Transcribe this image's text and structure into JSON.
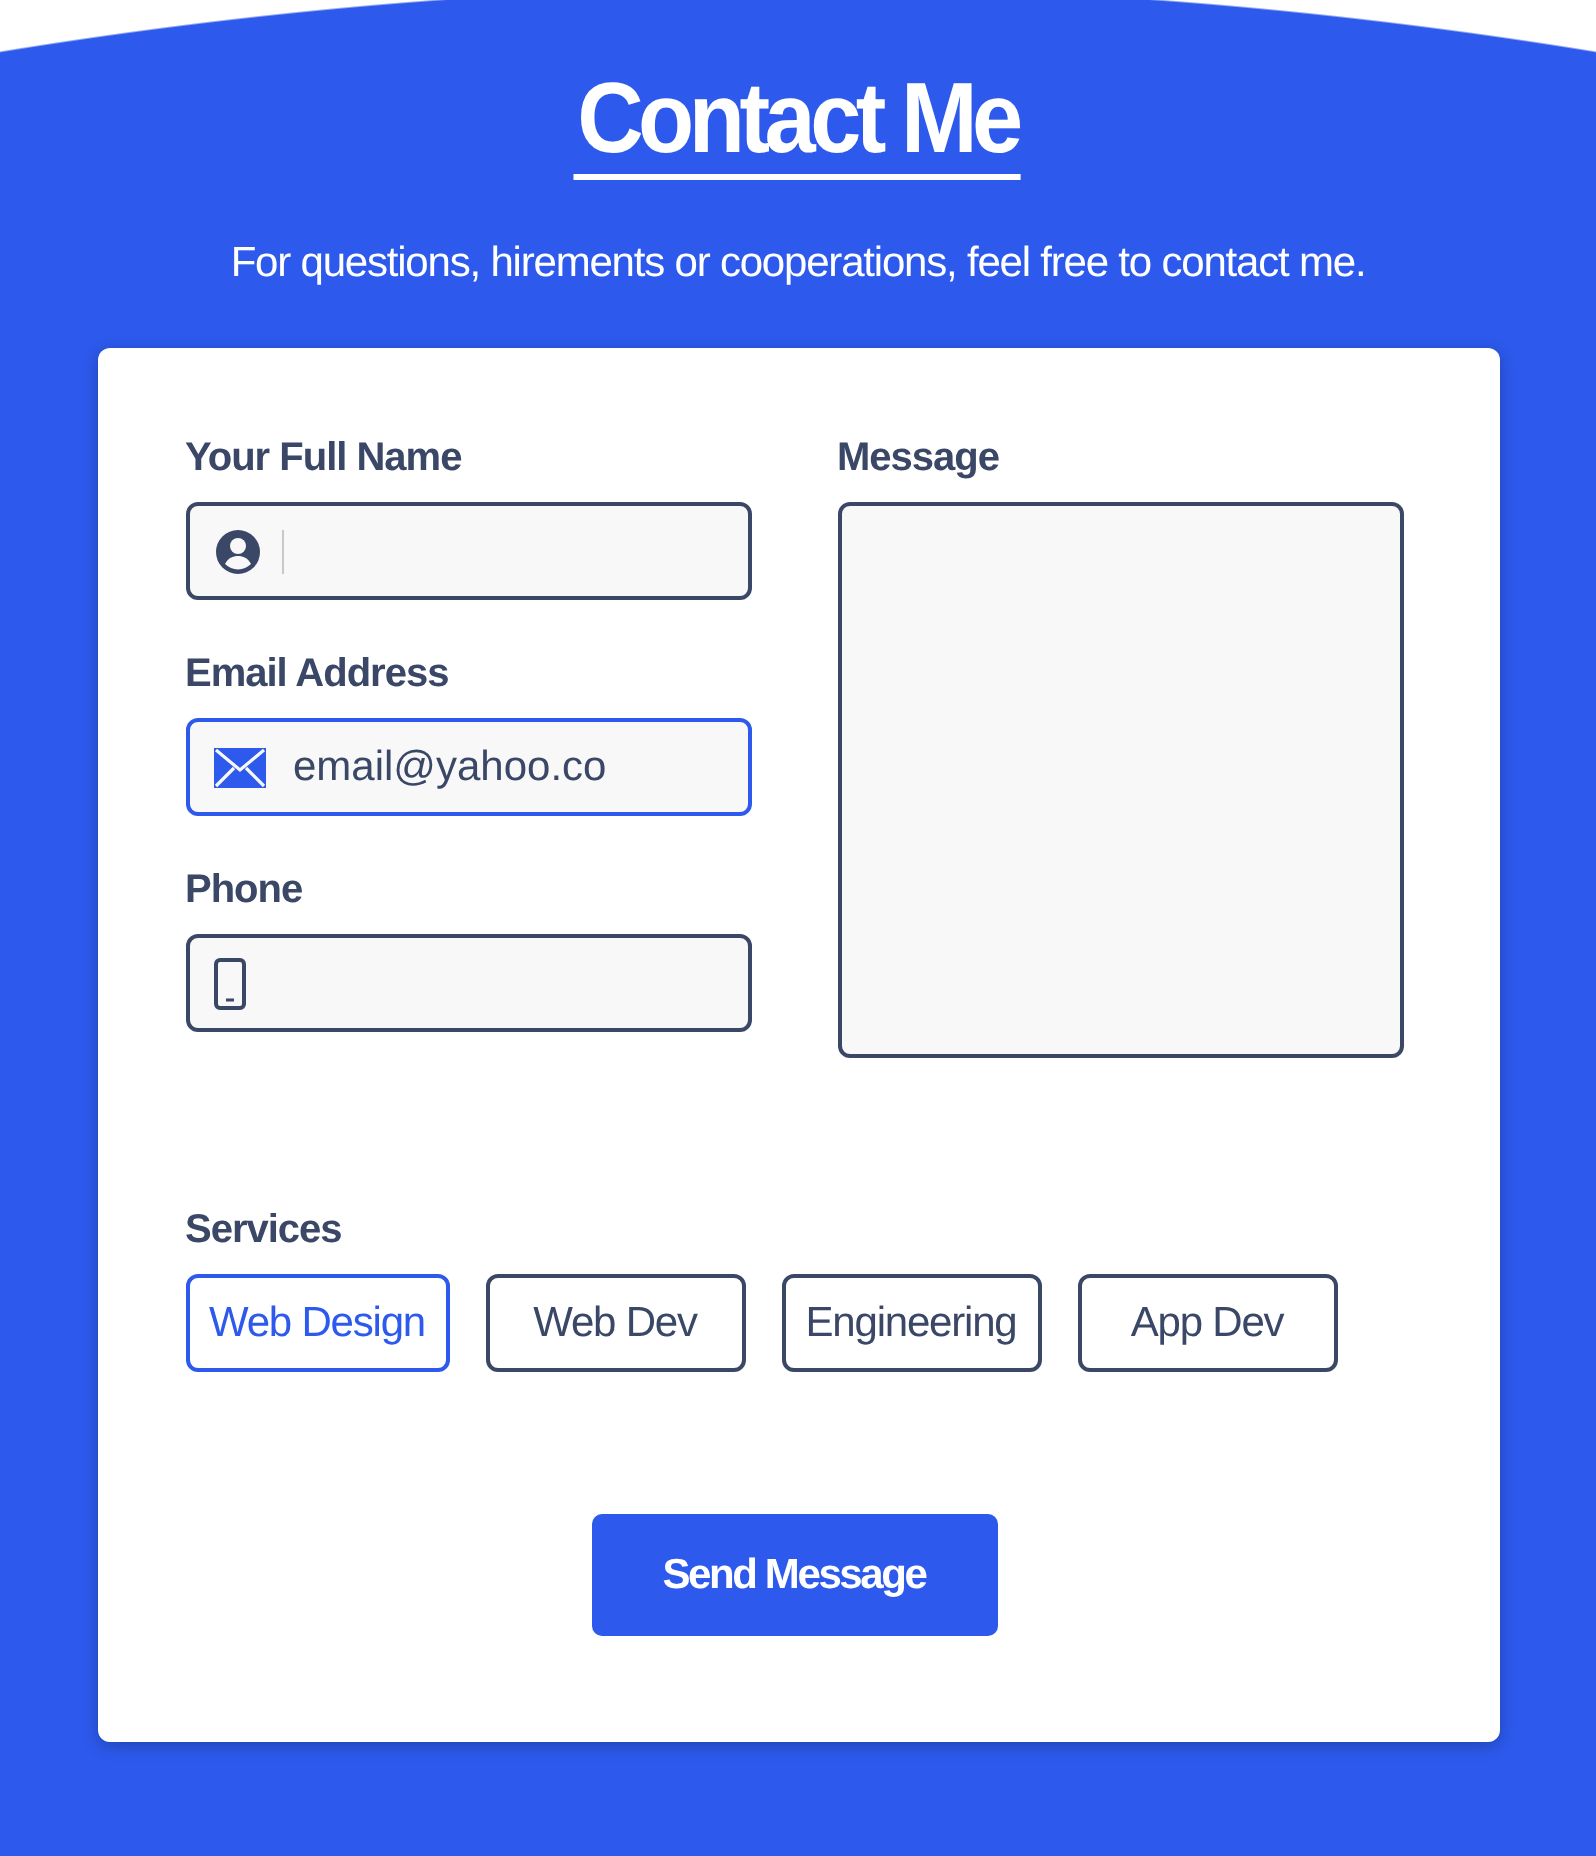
{
  "header": {
    "title": "Contact Me",
    "subtitle": "For questions, hirements or cooperations, feel free to contact me."
  },
  "fields": [
    {
      "kind": "name",
      "label": "Your Full Name",
      "focused": false
    },
    {
      "kind": "email",
      "label": "Email Address",
      "value": "email@yahoo.co",
      "focused": true
    },
    {
      "kind": "phone",
      "label": "Phone",
      "focused": false
    }
  ],
  "message": {
    "label": "Message"
  },
  "services": {
    "label": "Services",
    "options": [
      {
        "label": "Web Design",
        "selected": true
      },
      {
        "label": "Web Dev",
        "selected": false
      },
      {
        "label": "Engineering",
        "selected": false
      },
      {
        "label": "App Dev",
        "selected": false
      }
    ]
  },
  "submit": {
    "label": "Send Message"
  }
}
